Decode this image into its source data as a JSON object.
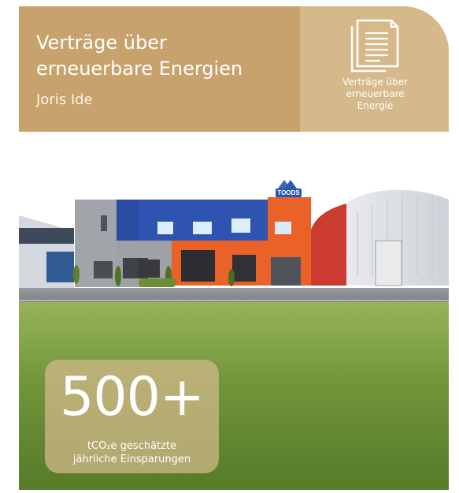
{
  "header": {
    "title": "Verträge über\nerneuerbare Energien",
    "author": "Joris Ide",
    "side_label": "Verträge über\nerneuerbare\nEnergie",
    "icon": "document-icon"
  },
  "photo": {
    "building_sign": "TOODS"
  },
  "stat": {
    "value": "500+",
    "label": "tCO₂e geschätzte\njährliche Einsparungen"
  },
  "colors": {
    "header_main": "#c7a26d",
    "header_side": "#d6b98a",
    "accent_text": "#ffffff",
    "stat_box": "#d6ba8c"
  }
}
